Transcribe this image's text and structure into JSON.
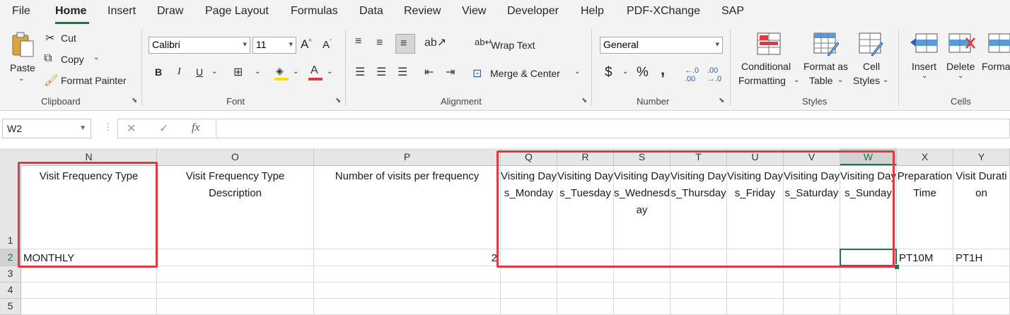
{
  "menu": {
    "items": [
      "File",
      "Home",
      "Insert",
      "Draw",
      "Page Layout",
      "Formulas",
      "Data",
      "Review",
      "View",
      "Developer",
      "Help",
      "PDF-XChange",
      "SAP"
    ],
    "active": "Home"
  },
  "ribbon": {
    "clipboard": {
      "paste": "Paste",
      "cut": "Cut",
      "copy": "Copy",
      "format_painter": "Format Painter",
      "label": "Clipboard"
    },
    "font": {
      "name": "Calibri",
      "size": "11",
      "bold": "B",
      "italic": "I",
      "underline": "U",
      "label": "Font"
    },
    "alignment": {
      "wrap_text": "Wrap Text",
      "merge_center": "Merge & Center",
      "label": "Alignment"
    },
    "number": {
      "format": "General",
      "currency": "$",
      "percent": "%",
      "comma": ",",
      "label": "Number"
    },
    "styles": {
      "conditional": "Conditional",
      "formatting": "Formatting",
      "format_as": "Format as",
      "table": "Table",
      "cell": "Cell",
      "cell_styles": "Styles",
      "label": "Styles"
    },
    "cells": {
      "insert": "Insert",
      "delete": "Delete",
      "format": "Forma",
      "label": "Cells"
    }
  },
  "formula_bar": {
    "name_box": "W2",
    "cancel": "✕",
    "enter": "✓",
    "fx": "fx",
    "value": ""
  },
  "colors": {
    "accent": "#217346",
    "highlight_box": "#e0393f",
    "ribbon_bg": "#f3f3f3"
  },
  "sheet": {
    "columns": [
      "N",
      "O",
      "P",
      "Q",
      "R",
      "S",
      "T",
      "U",
      "V",
      "W",
      "X",
      "Y"
    ],
    "rows": [
      "1",
      "2",
      "3",
      "4",
      "5"
    ],
    "selected_column": "W",
    "active_cell": "W2",
    "headers": {
      "N": "Visit Frequency Type",
      "O": "Visit Frequency Type Description",
      "P": "Number of visits per frequency",
      "Q": "Visiting Days_Monday",
      "R": "Visiting Days_Tuesday",
      "S": "Visiting Days_Wednesday",
      "T": "Visiting Days_Thursday",
      "U": "Visiting Days_Friday",
      "V": "Visiting Days_Saturday",
      "W": "Visiting Days_Sunday",
      "X": "Preparation Time",
      "Y": "Visit Duration"
    },
    "row2": {
      "N": "MONTHLY",
      "P": "2",
      "X": "PT10M",
      "Y": "PT1H"
    }
  }
}
